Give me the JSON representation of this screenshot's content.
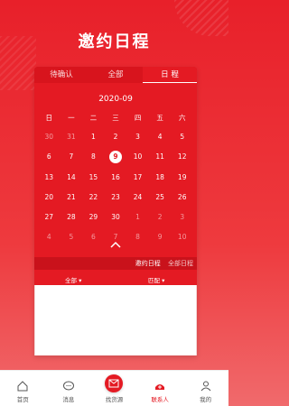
{
  "page": {
    "title": "邀约日程"
  },
  "tabs": [
    {
      "label": "待确认"
    },
    {
      "label": "全部"
    },
    {
      "label": "日 程"
    }
  ],
  "calendar": {
    "month": "2020-09",
    "weekdays": [
      "日",
      "一",
      "二",
      "三",
      "四",
      "五",
      "六"
    ],
    "weeks": [
      [
        "30",
        "31",
        "1",
        "2",
        "3",
        "4",
        "5"
      ],
      [
        "6",
        "7",
        "8",
        "9",
        "10",
        "11",
        "12"
      ],
      [
        "13",
        "14",
        "15",
        "16",
        "17",
        "18",
        "19"
      ],
      [
        "20",
        "21",
        "22",
        "23",
        "24",
        "25",
        "26"
      ],
      [
        "27",
        "28",
        "29",
        "30",
        "1",
        "2",
        "3"
      ],
      [
        "4",
        "5",
        "6",
        "7",
        "8",
        "9",
        "10"
      ]
    ]
  },
  "subtabs": {
    "active": "邀约日程",
    "other": "全部日程"
  },
  "filters": {
    "left": "全部 ▾",
    "right": "匹配 ▾"
  },
  "bottom_nav": [
    {
      "label": "首页",
      "icon": "home-icon"
    },
    {
      "label": "消息",
      "icon": "chat-icon"
    },
    {
      "label": "找货源",
      "icon": "envelope-icon"
    },
    {
      "label": "联系人",
      "icon": "contact-add-icon"
    },
    {
      "label": "我的",
      "icon": "person-icon"
    }
  ],
  "colors": {
    "primary": "#e41a23",
    "primary_dark": "#c9121b"
  }
}
